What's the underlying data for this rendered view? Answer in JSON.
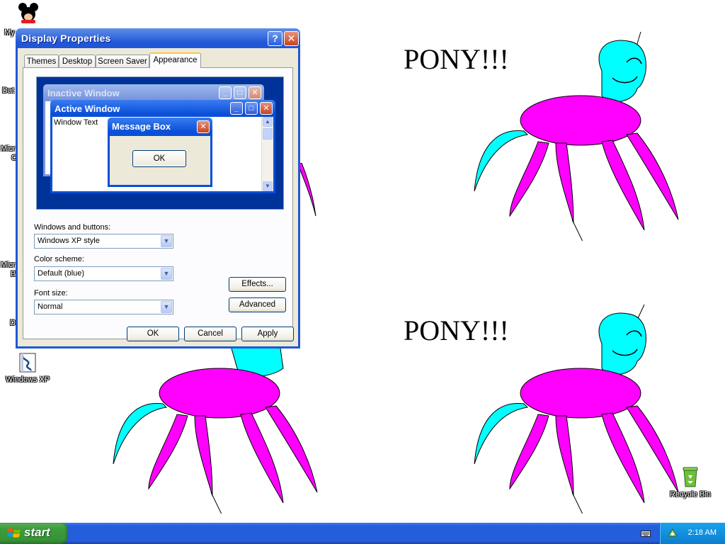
{
  "desktop": {
    "wallpaper_texts": [
      "PONY!!!",
      "PONY!!!"
    ],
    "icons": [
      {
        "label": "My",
        "icon": "mickey-icon"
      },
      {
        "label": "Dat",
        "icon": "generic-icon"
      },
      {
        "label": "Micr",
        "icon": "generic-icon"
      },
      {
        "label": "C",
        "icon": "generic-icon"
      },
      {
        "label": "Micr",
        "icon": "generic-icon"
      },
      {
        "label": "B",
        "icon": "generic-icon"
      },
      {
        "label": "D",
        "icon": "generic-icon"
      },
      {
        "label": "Windows XP",
        "icon": "windows-xp-setup-icon"
      },
      {
        "label": "Recycle Bin",
        "icon": "recycle-bin-icon"
      }
    ],
    "colors": {
      "pony_head": "#00ffff",
      "pony_body": "#ff00ff"
    }
  },
  "dialog": {
    "title": "Display Properties",
    "help_glyph": "?",
    "close_glyph": "✕",
    "tabs": [
      "Themes",
      "Desktop",
      "Screen Saver",
      "Appearance"
    ],
    "active_tab": "Appearance",
    "preview": {
      "inactive_title": "Inactive Window",
      "active_title": "Active Window",
      "window_text": "Window Text",
      "message_title": "Message Box",
      "message_ok": "OK"
    },
    "windows_buttons_label": "Windows and buttons:",
    "windows_buttons_value": "Windows XP style",
    "color_scheme_label": "Color scheme:",
    "color_scheme_value": "Default (blue)",
    "font_size_label": "Font size:",
    "font_size_value": "Normal",
    "effects_button": "Effects...",
    "advanced_button": "Advanced",
    "ok_button": "OK",
    "cancel_button": "Cancel",
    "apply_button": "Apply"
  },
  "taskbar": {
    "start_label": "start",
    "clock": "2:18 AM"
  }
}
